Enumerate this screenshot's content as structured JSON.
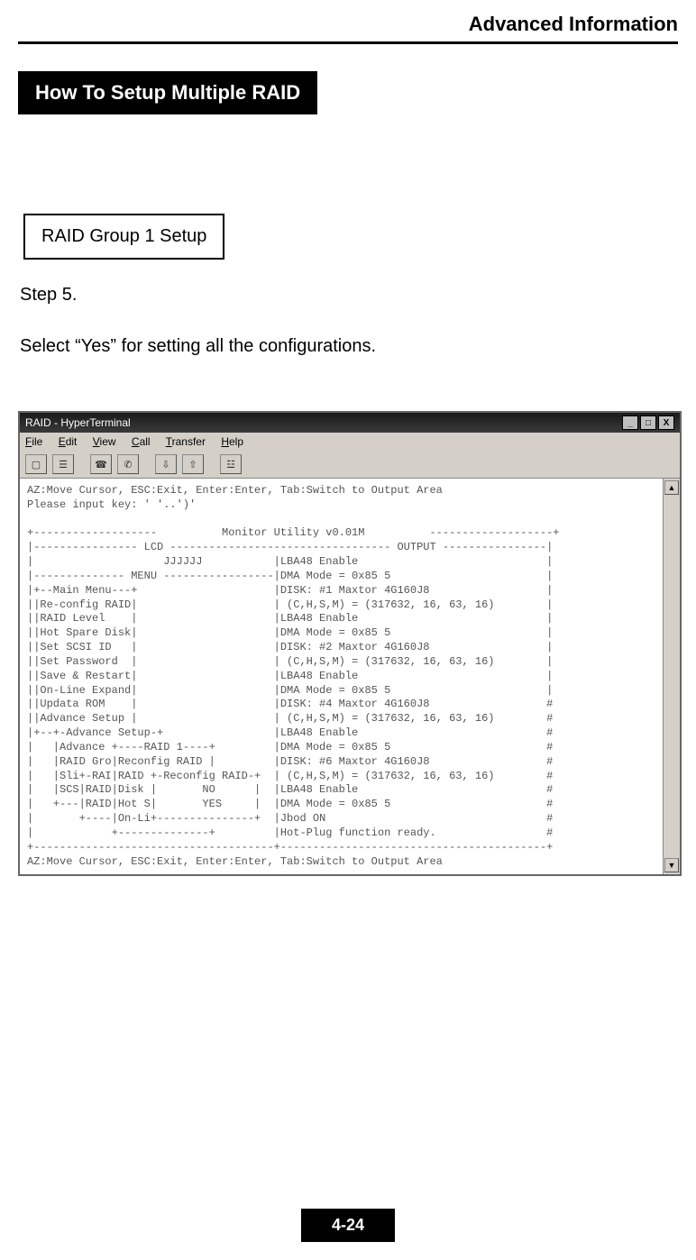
{
  "header": {
    "title": "Advanced Information"
  },
  "section": {
    "title": "How To Setup Multiple RAID"
  },
  "callout": {
    "text": "RAID Group 1 Setup"
  },
  "step": {
    "label": "Step 5."
  },
  "instruction": {
    "text": "Select “Yes” for setting all the configurations."
  },
  "window": {
    "title": "RAID - HyperTerminal",
    "sysbuttons": {
      "min": "_",
      "max": "□",
      "close": "X"
    },
    "menubar": {
      "file": "File",
      "edit": "Edit",
      "view": "View",
      "call": "Call",
      "transfer": "Transfer",
      "help": "Help"
    },
    "toolbar_icons": [
      "new-doc-icon",
      "open-icon",
      "connect-icon",
      "disconnect-icon",
      "send-icon",
      "receive-icon",
      "properties-icon"
    ],
    "terminal_lines": [
      "AZ:Move Cursor, ESC:Exit, Enter:Enter, Tab:Switch to Output Area",
      "Please input key: ' '..')'",
      "",
      "+-------------------          Monitor Utility v0.01M          -------------------+",
      "|---------------- LCD ---------------------------------- OUTPUT ----------------|",
      "|                    JJJJJJ           |LBA48 Enable                             |",
      "|-------------- MENU -----------------|DMA Mode = 0x85 5                        |",
      "|+--Main Menu---+                     |DISK: #1 Maxtor 4G160J8                  |",
      "||Re-config RAID|                     | (C,H,S,M) = (317632, 16, 63, 16)        |",
      "||RAID Level    |                     |LBA48 Enable                             |",
      "||Hot Spare Disk|                     |DMA Mode = 0x85 5                        |",
      "||Set SCSI ID   |                     |DISK: #2 Maxtor 4G160J8                  |",
      "||Set Password  |                     | (C,H,S,M) = (317632, 16, 63, 16)        |",
      "||Save & Restart|                     |LBA48 Enable                             |",
      "||On-Line Expand|                     |DMA Mode = 0x85 5                        |",
      "||Updata ROM    |                     |DISK: #4 Maxtor 4G160J8                  #",
      "||Advance Setup |                     | (C,H,S,M) = (317632, 16, 63, 16)        #",
      "|+--+-Advance Setup-+                 |LBA48 Enable                             #",
      "|   |Advance +----RAID 1----+         |DMA Mode = 0x85 5                        #",
      "|   |RAID Gro|Reconfig RAID |         |DISK: #6 Maxtor 4G160J8                  #",
      "|   |Sli+-RAI|RAID +-Reconfig RAID-+  | (C,H,S,M) = (317632, 16, 63, 16)        #",
      "|   |SCS|RAID|Disk |       NO      |  |LBA48 Enable                             #",
      "|   +---|RAID|Hot S|       YES     |  |DMA Mode = 0x85 5                        #",
      "|       +----|On-Li+---------------+  |Jbod ON                                  #",
      "|            +--------------+         |Hot-Plug function ready.                 #",
      "+-------------------------------------+-----------------------------------------+",
      "AZ:Move Cursor, ESC:Exit, Enter:Enter, Tab:Switch to Output Area"
    ]
  },
  "footer": {
    "page": "4-24"
  }
}
